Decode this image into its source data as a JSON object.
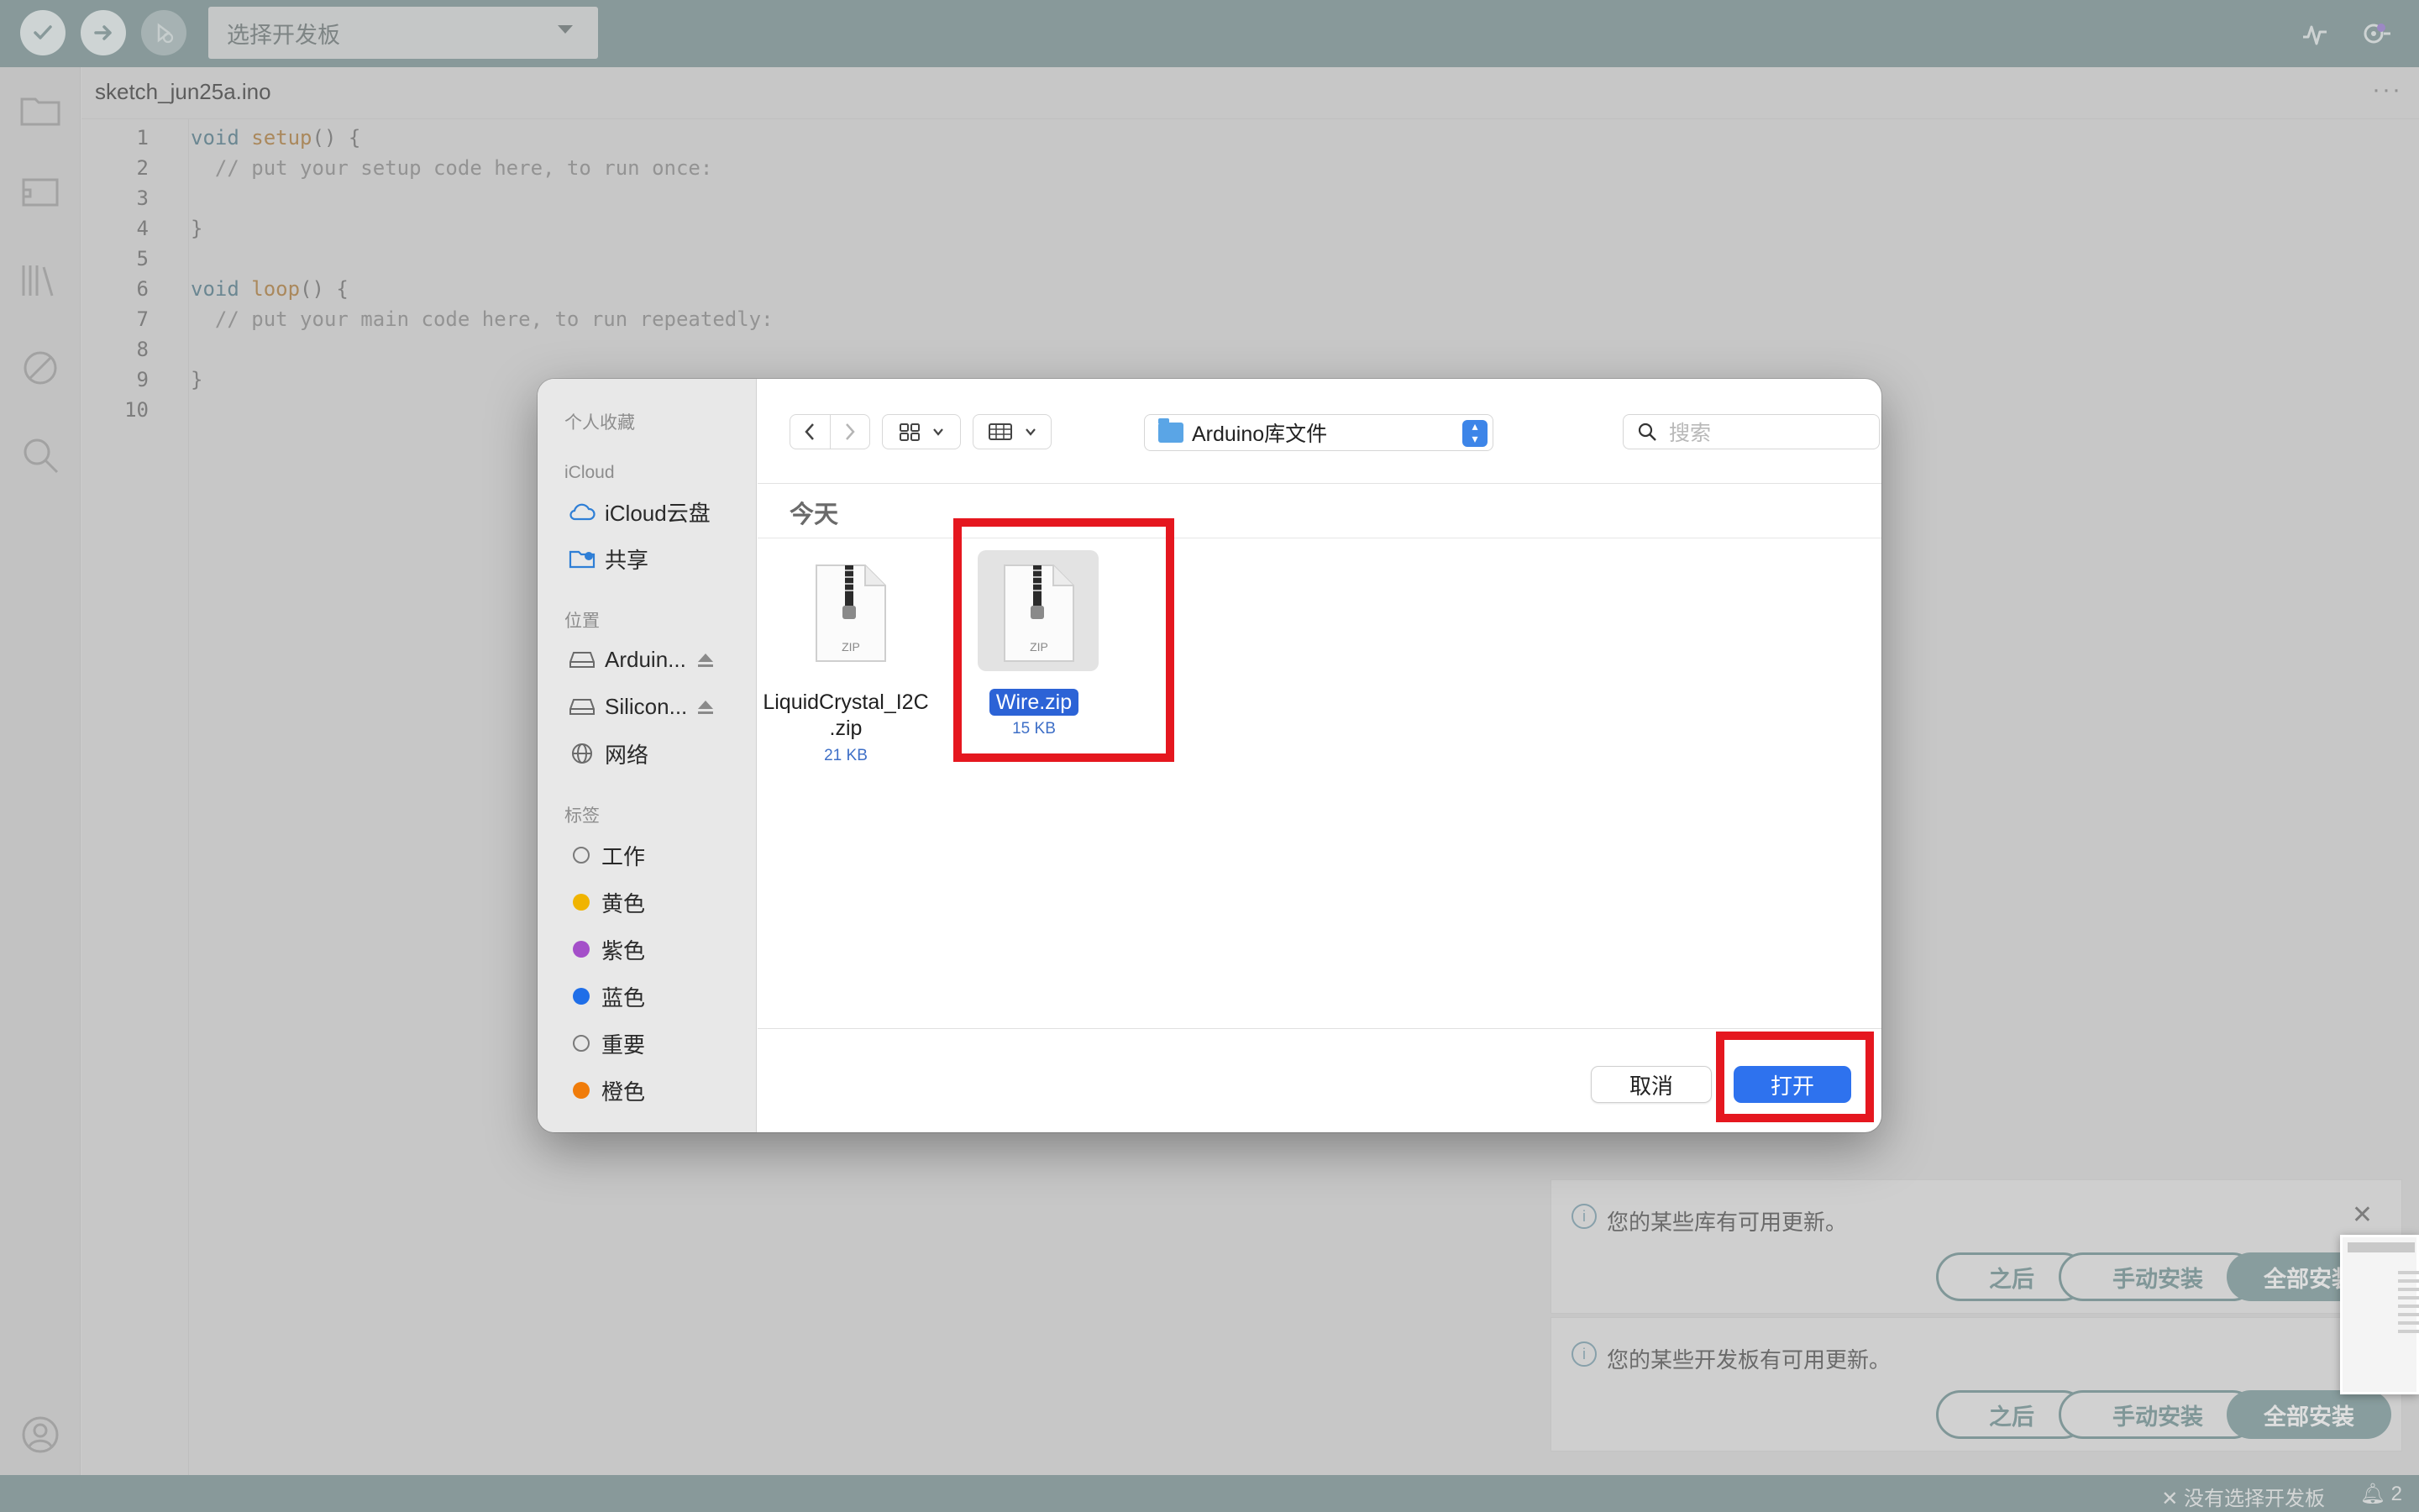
{
  "toolbar": {
    "board_placeholder": "选择开发板",
    "verify_icon": "check-icon",
    "upload_icon": "arrow-right-icon",
    "debug_icon": "debug-icon",
    "accent": "#7b9697"
  },
  "editor": {
    "file_tab": "sketch_jun25a.ino",
    "more": "···",
    "line_numbers": [
      "1",
      "2",
      "3",
      "4",
      "5",
      "6",
      "7",
      "8",
      "9",
      "10"
    ],
    "code": {
      "l1_kw": "void",
      "l1_fn": "setup",
      "l1_rest": "() {",
      "l2": "  // put your setup code here, to run once:",
      "l4": "}",
      "l6_kw": "void",
      "l6_fn": "loop",
      "l6_rest": "() {",
      "l7": "  // put your main code here, to run repeatedly:",
      "l9": "}"
    }
  },
  "dialog": {
    "sidebar": {
      "favorites_heading": "个人收藏",
      "icloud_heading": "iCloud",
      "icloud_drive": "iCloud云盘",
      "shared": "共享",
      "locations_heading": "位置",
      "loc_arduino": "Arduin...",
      "loc_silicon": "Silicon...",
      "network": "网络",
      "tags_heading": "标签",
      "tags": [
        {
          "label": "工作",
          "color": ""
        },
        {
          "label": "黄色",
          "color": "#f0b400"
        },
        {
          "label": "紫色",
          "color": "#a44fc9"
        },
        {
          "label": "蓝色",
          "color": "#1f6ee8"
        },
        {
          "label": "重要",
          "color": ""
        },
        {
          "label": "橙色",
          "color": "#f07c0a"
        }
      ]
    },
    "path": "Arduino库文件",
    "search_placeholder": "搜索",
    "section_label": "今天",
    "files": [
      {
        "name_line1": "LiquidCrystal_I2C",
        "name_line2": ".zip",
        "size": "21 KB",
        "type_label": "ZIP",
        "selected": false
      },
      {
        "name_line1": "Wire.zip",
        "name_line2": "",
        "size": "15 KB",
        "type_label": "ZIP",
        "selected": true
      }
    ],
    "cancel_label": "取消",
    "open_label": "打开",
    "open_color": "#2e72ee"
  },
  "notifications": [
    {
      "message": "您的某些库有可用更新。",
      "later": "之后",
      "manual": "手动安装",
      "all": "全部安装"
    },
    {
      "message": "您的某些开发板有可用更新。",
      "later": "之后",
      "manual": "手动安装",
      "all": "全部安装"
    }
  ],
  "statusbar": {
    "no_board": "没有选择开发板",
    "count": "2"
  }
}
